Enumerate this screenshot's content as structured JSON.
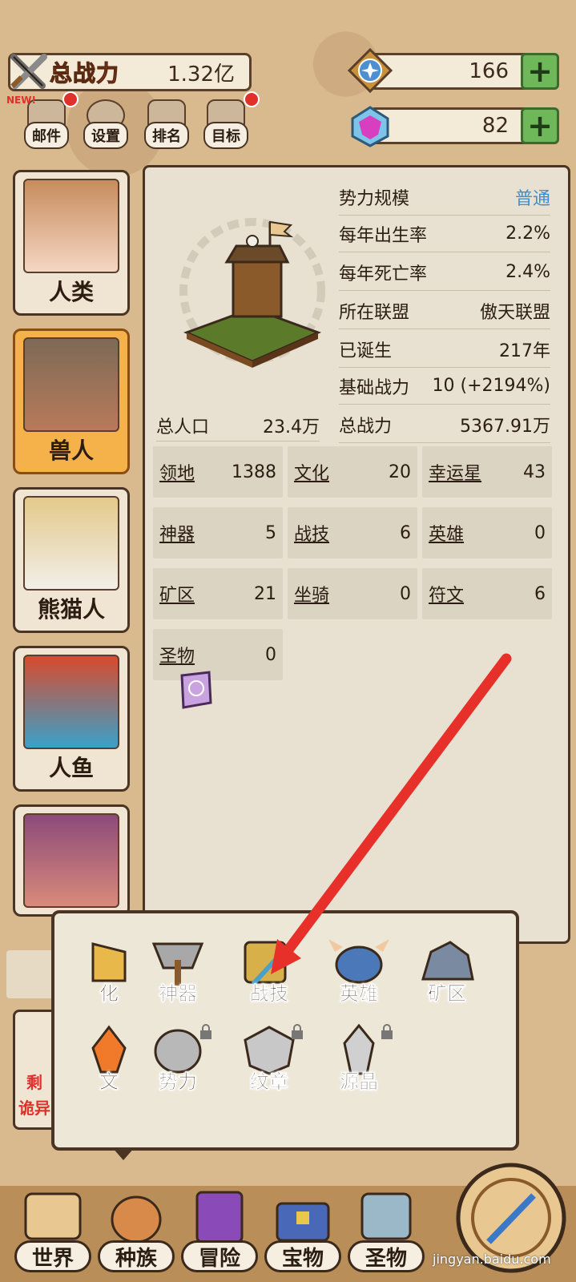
{
  "header": {
    "power_label": "总战力",
    "power_value": "1.32亿",
    "star_value": "166",
    "gem_value": "82",
    "plus": "+"
  },
  "menu": [
    {
      "label": "邮件",
      "badge": true
    },
    {
      "label": "设置",
      "badge": false
    },
    {
      "label": "排名",
      "badge": false
    },
    {
      "label": "目标",
      "badge": true
    }
  ],
  "new_badge": "NEW!",
  "races": [
    {
      "name": "人类",
      "active": false
    },
    {
      "name": "兽人",
      "active": true
    },
    {
      "name": "熊猫人",
      "active": false
    },
    {
      "name": "人鱼",
      "active": false
    }
  ],
  "info": {
    "rows": [
      {
        "k": "势力规模",
        "v": "普通"
      },
      {
        "k": "每年出生率",
        "v": "2.2%"
      },
      {
        "k": "每年死亡率",
        "v": "2.4%"
      },
      {
        "k": "所在联盟",
        "v": "傲天联盟"
      },
      {
        "k": "已诞生",
        "v": "217年"
      },
      {
        "k": "基础战力",
        "v": "10 (+2194%)"
      },
      {
        "k": "总战力",
        "v": "5367.91万"
      }
    ],
    "population_label": "总人口",
    "population_value": "23.4万",
    "stats": [
      {
        "k": "领地",
        "v": "1388"
      },
      {
        "k": "文化",
        "v": "20"
      },
      {
        "k": "幸运星",
        "v": "43"
      },
      {
        "k": "神器",
        "v": "5"
      },
      {
        "k": "战技",
        "v": "6"
      },
      {
        "k": "英雄",
        "v": "0"
      },
      {
        "k": "矿区",
        "v": "21"
      },
      {
        "k": "坐骑",
        "v": "0"
      },
      {
        "k": "符文",
        "v": "6"
      },
      {
        "k": "圣物",
        "v": "0"
      }
    ]
  },
  "popup": {
    "items": [
      {
        "label": "化",
        "locked": false
      },
      {
        "label": "神器",
        "locked": false
      },
      {
        "label": "战技",
        "locked": false
      },
      {
        "label": "英雄",
        "locked": false
      },
      {
        "label": "矿区",
        "locked": false
      },
      {
        "label": "文",
        "locked": false
      },
      {
        "label": "势力",
        "locked": true
      },
      {
        "label": "纹章",
        "locked": true
      },
      {
        "label": "源晶",
        "locked": true
      }
    ]
  },
  "left_partial": {
    "line1": "剩",
    "line2": "诡异"
  },
  "nav": [
    {
      "label": "世界"
    },
    {
      "label": "种族"
    },
    {
      "label": "冒险"
    },
    {
      "label": "宝物"
    },
    {
      "label": "圣物"
    }
  ],
  "watermark": "jingyan.baidu.com",
  "colors": {
    "accent_red": "#e0302a",
    "arrow": "#e8302a",
    "active_race": "#f5b24a",
    "link_blue": "#3b8fd6",
    "plus_green": "#6fb85a"
  }
}
